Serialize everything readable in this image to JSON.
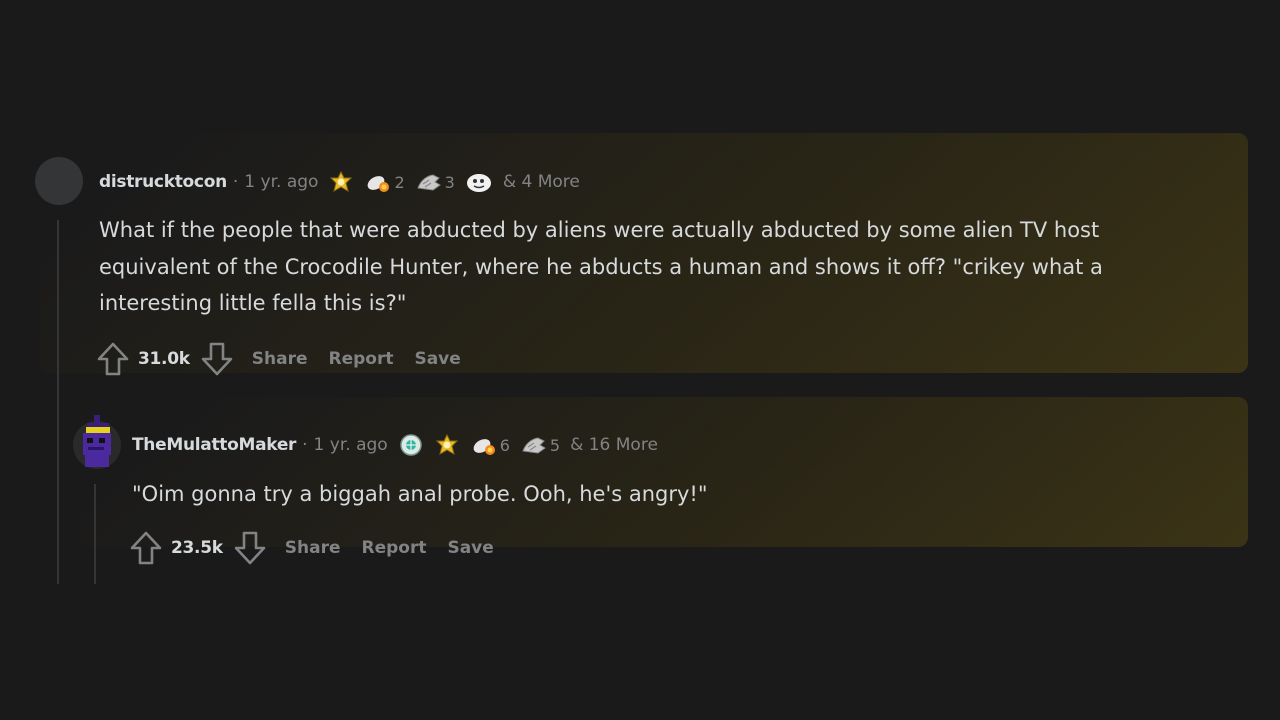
{
  "comments": [
    {
      "username": "distrucktocon",
      "separator": "·",
      "time": "1 yr. ago",
      "awards": [
        {
          "icon": "gold-award-icon",
          "count": ""
        },
        {
          "icon": "rocket-like-award-icon",
          "count": "2"
        },
        {
          "icon": "silver-hands-award-icon",
          "count": "3"
        },
        {
          "icon": "face-award-icon",
          "count": ""
        }
      ],
      "more_awards": "& 4 More",
      "body": "What if the people that were abducted by aliens were actually abducted by some alien TV host equivalent of the Crocodile Hunter, where he abducts a human and shows it off? \"crikey what a interesting little fella this is?\"",
      "score": "31.0k",
      "share_label": "Share",
      "report_label": "Report",
      "save_label": "Save"
    },
    {
      "username": "TheMulattoMaker",
      "separator": "·",
      "time": "1 yr. ago",
      "awards": [
        {
          "icon": "globe-award-icon",
          "count": ""
        },
        {
          "icon": "gold-award-icon",
          "count": ""
        },
        {
          "icon": "rocket-like-award-icon",
          "count": "6"
        },
        {
          "icon": "silver-hands-award-icon",
          "count": "5"
        }
      ],
      "more_awards": "& 16 More",
      "body": "\"Oim gonna try a biggah anal probe. Ooh, he's angry!\"",
      "score": "23.5k",
      "share_label": "Share",
      "report_label": "Report",
      "save_label": "Save"
    }
  ],
  "colors": {
    "background": "#1a1a1b",
    "text": "#d7dadc",
    "muted": "#818384",
    "thread_line": "#343536"
  }
}
